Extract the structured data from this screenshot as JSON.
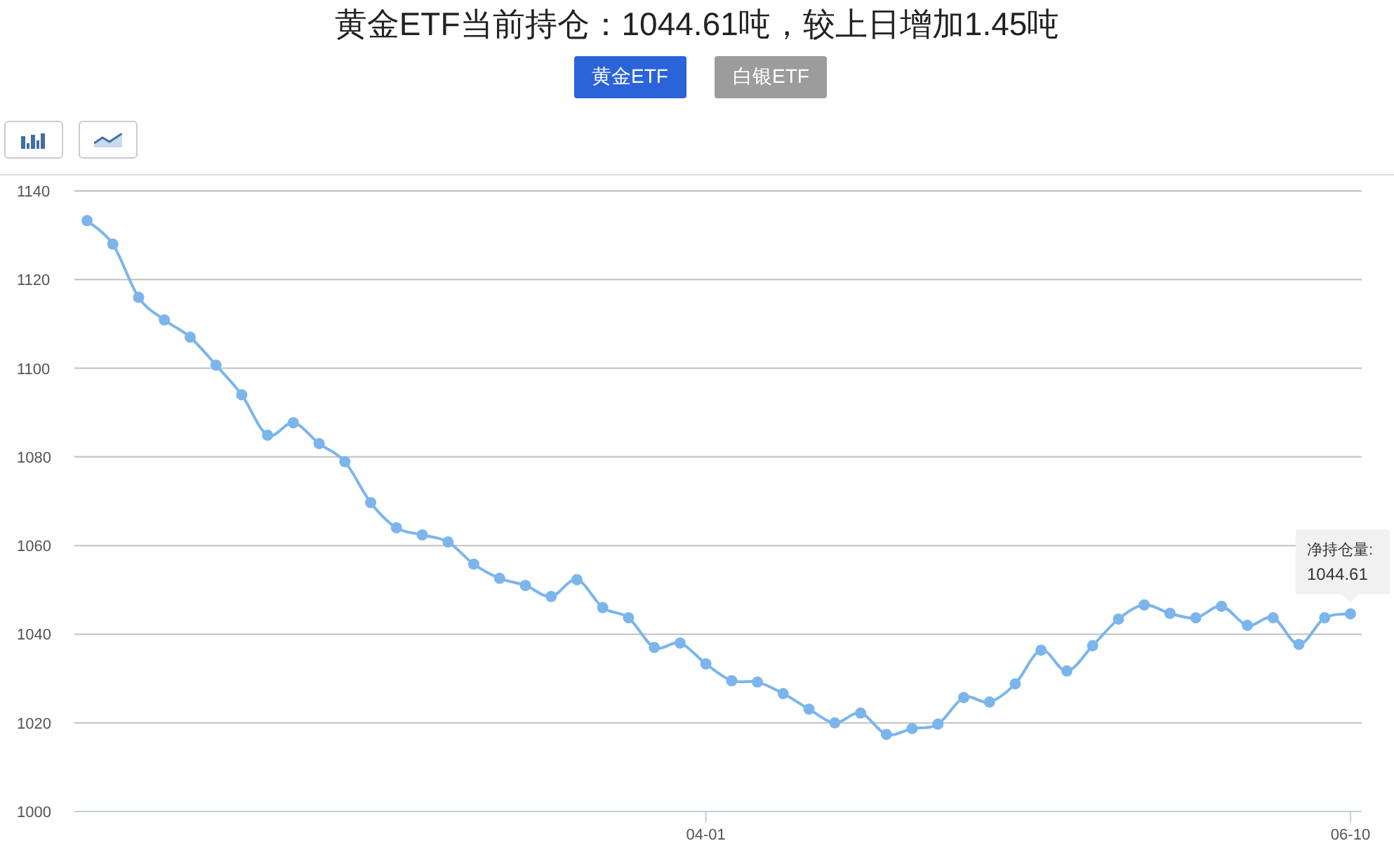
{
  "title": "黄金ETF当前持仓：1044.61吨，较上日增加1.45吨",
  "tabs": [
    {
      "label": "黄金ETF",
      "selected": true
    },
    {
      "label": "白银ETF",
      "selected": false
    }
  ],
  "chart_types": [
    {
      "kind": "bar"
    },
    {
      "kind": "line"
    }
  ],
  "chart_data": {
    "type": "line",
    "grid": true,
    "ylim": [
      1000,
      1140
    ],
    "yticks": [
      1000,
      1020,
      1040,
      1060,
      1080,
      1100,
      1120,
      1140
    ],
    "categories": [
      null,
      null,
      null,
      null,
      null,
      null,
      null,
      null,
      null,
      null,
      null,
      null,
      null,
      null,
      null,
      null,
      null,
      null,
      null,
      null,
      null,
      null,
      null,
      null,
      "04-01",
      null,
      null,
      null,
      null,
      null,
      null,
      null,
      null,
      null,
      null,
      null,
      null,
      null,
      null,
      null,
      null,
      null,
      null,
      null,
      null,
      null,
      null,
      null,
      null,
      "06-10"
    ],
    "series": [
      {
        "marker": true,
        "color": "#7cb5ec",
        "values": [
          1133.3,
          1128,
          1116,
          1110.9,
          1107,
          1100.7,
          1094,
          1084.9,
          1087.7,
          1083,
          1078.9,
          1069.7,
          1064,
          1062.4,
          1060.8,
          1055.8,
          1052.6,
          1051,
          1048.5,
          1052.3,
          1046,
          1043.7,
          1037,
          1038,
          1033.3,
          1029.5,
          1029.2,
          1026.6,
          1023.1,
          1020,
          1022.2,
          1017.4,
          1018.7,
          1019.7,
          1025.7,
          1024.7,
          1028.8,
          1036.4,
          1031.7,
          1037.4,
          1043.4,
          1046.6,
          1044.7,
          1043.7,
          1046.3,
          1042,
          1043.7,
          1037.7,
          1043.7,
          1044.6
        ]
      }
    ]
  },
  "tooltip": {
    "label": "净持仓量:",
    "value": "1044.61"
  }
}
